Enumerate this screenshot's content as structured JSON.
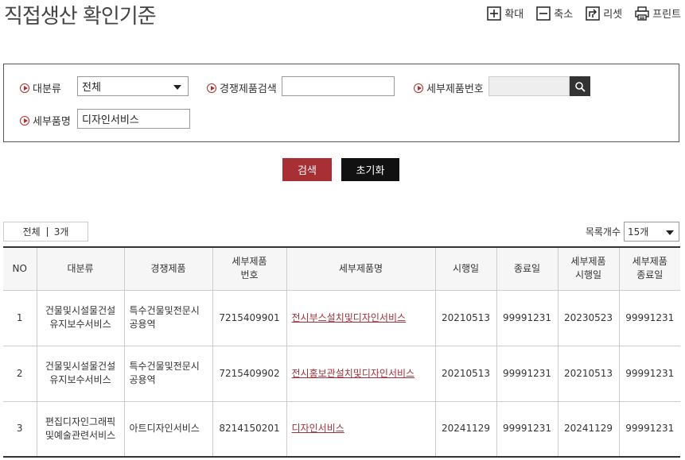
{
  "page": {
    "title": "직접생산 확인기준"
  },
  "tools": [
    {
      "name": "zoom-in",
      "label": "확대",
      "icon": "plus-icon"
    },
    {
      "name": "zoom-out",
      "label": "축소",
      "icon": "minus-icon"
    },
    {
      "name": "reset",
      "label": "리셋",
      "icon": "reset-icon"
    },
    {
      "name": "print",
      "label": "프린트",
      "icon": "printer-icon"
    }
  ],
  "search": {
    "category_label": "대분류",
    "category_value": "전체",
    "competing_label": "경쟁제품검색",
    "competing_value": "",
    "detail_no_label": "세부제품번호",
    "detail_no_value": "",
    "detail_name_label": "세부품명",
    "detail_name_value": "디자인서비스"
  },
  "buttons": {
    "search": "검색",
    "reset": "초기화"
  },
  "summary": {
    "total_label": "전체",
    "total_count": "3개"
  },
  "pagesize": {
    "label": "목록개수",
    "value": "15개"
  },
  "table": {
    "headers": [
      "NO",
      "대분류",
      "경쟁제품",
      "세부제품\n번호",
      "세부제품명",
      "시행일",
      "종료일",
      "세부제품\n시행일",
      "세부제품\n종료일"
    ],
    "rows": [
      [
        "1",
        "건물및시설물건설유지보수서비스",
        "특수건물및전문시공용역",
        "7215409901",
        "전시부스설치및디자인서비스",
        "20210513",
        "99991231",
        "20230523",
        "99991231"
      ],
      [
        "2",
        "건물및시설물건설유지보수서비스",
        "특수건물및전문시공용역",
        "7215409902",
        "전시홍보관설치및디자인서비스",
        "20210513",
        "99991231",
        "20210513",
        "99991231"
      ],
      [
        "3",
        "편집디자인그래픽및예술관련서비스",
        "아트디자인서비스",
        "8214150201",
        "디자인서비스",
        "20241129",
        "99991231",
        "20241129",
        "99991231"
      ]
    ]
  },
  "colors": {
    "accent": "#a83035",
    "dark": "#111111"
  }
}
